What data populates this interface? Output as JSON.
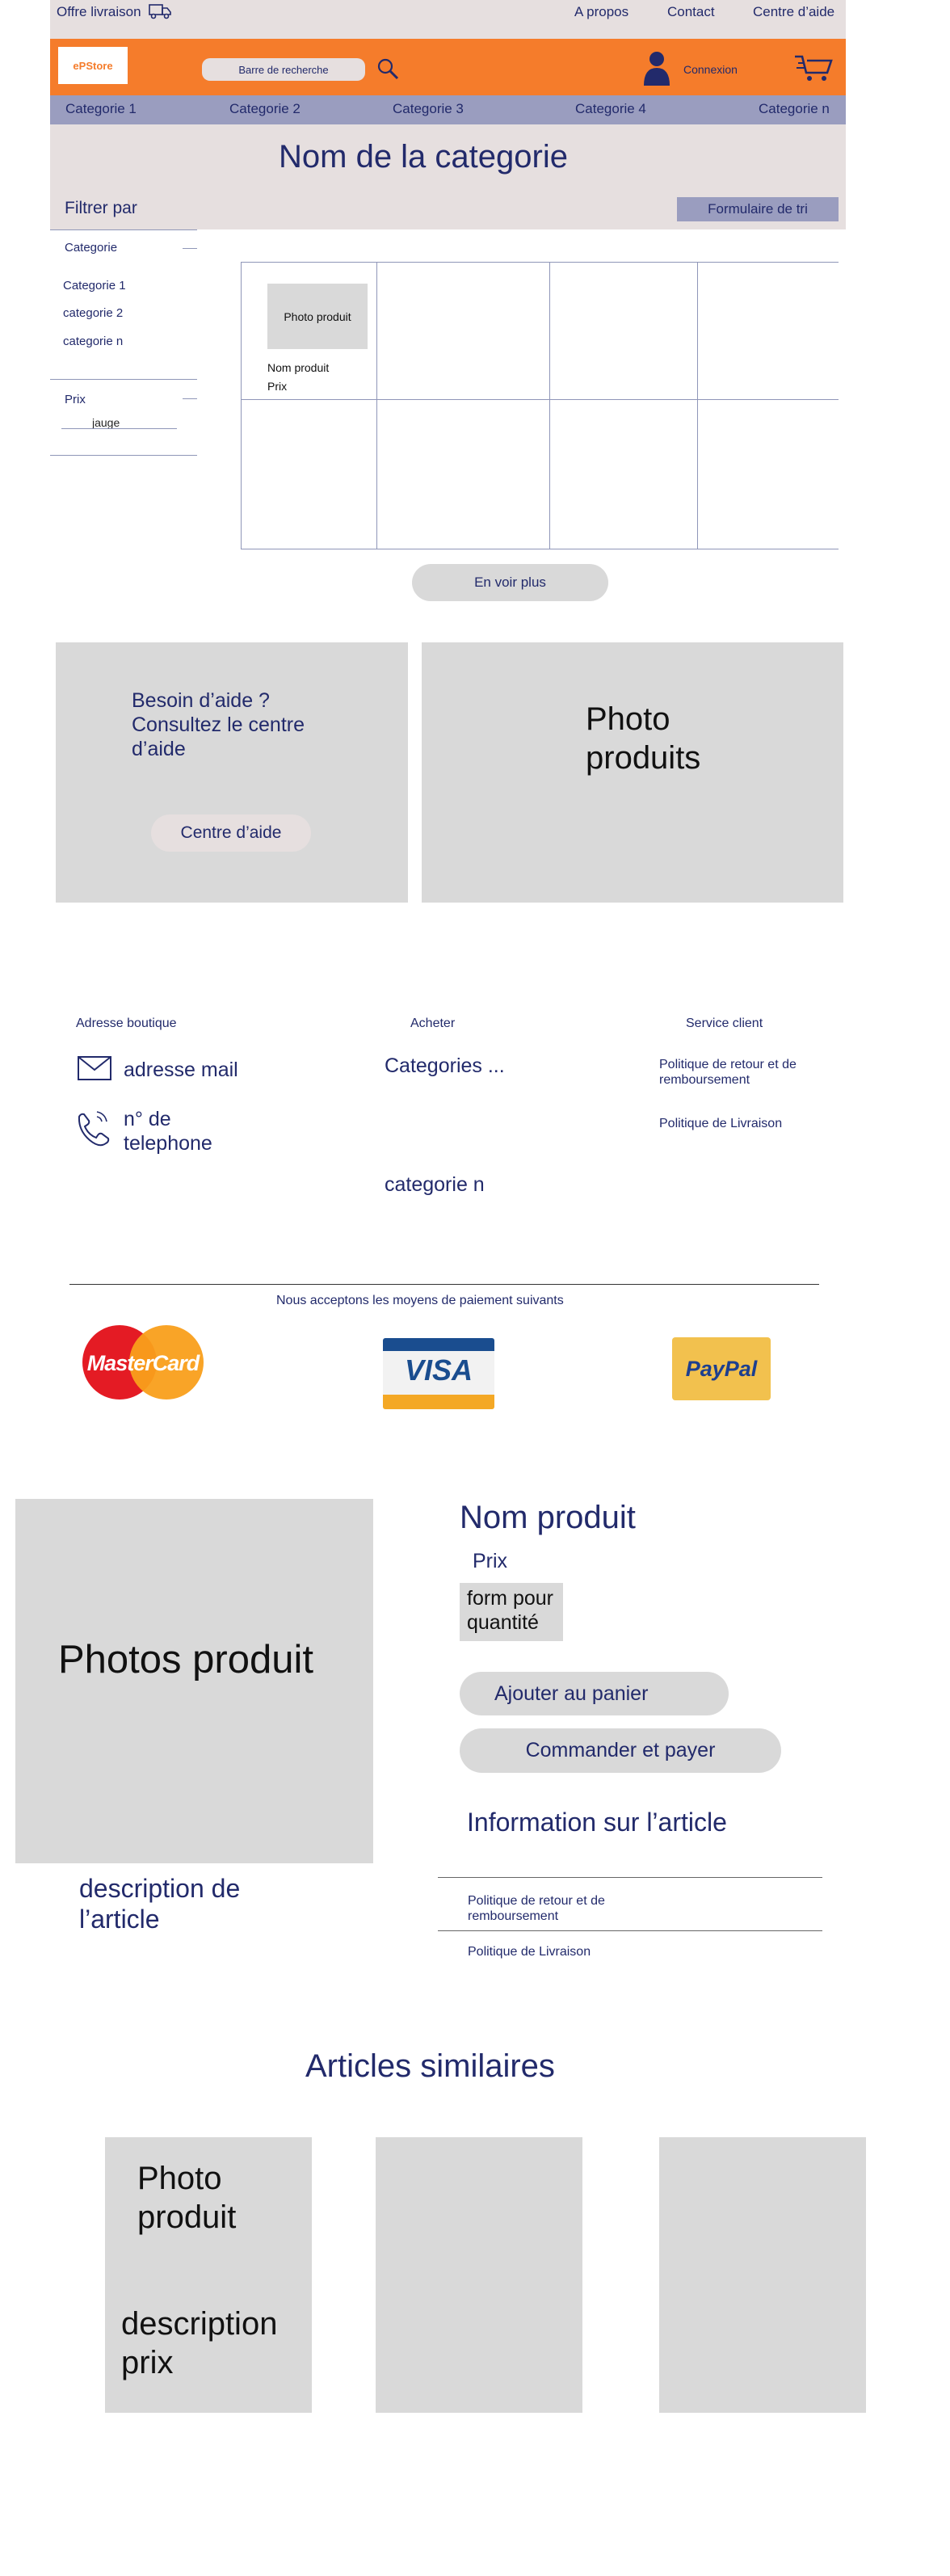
{
  "topbar": {
    "offer": "Offre livraison",
    "links": [
      "A propos",
      "Contact",
      "Centre d’aide"
    ]
  },
  "header": {
    "logo_text": "ePStore",
    "search_placeholder": "Barre de recherche",
    "login": "Connexion"
  },
  "categories_nav": [
    "Categorie 1",
    "Categorie 2",
    "Categorie 3",
    "Categorie 4",
    "Categorie n"
  ],
  "category_page": {
    "title": "Nom de la categorie",
    "filter_label": "Filtrer par",
    "sort_label": "Formulaire de tri",
    "filter_category_title": "Categorie",
    "filter_categories": [
      "Categorie 1",
      "categorie 2",
      "categorie n"
    ],
    "filter_price_title": "Prix",
    "price_gauge": "jauge",
    "product_photo": "Photo produit",
    "product_name": "Nom produit",
    "product_price": "Prix",
    "see_more": "En voir plus"
  },
  "help": {
    "text": "Besoin d’aide ? Consultez le centre d’aide",
    "button": "Centre d’aide",
    "photo": "Photo produits"
  },
  "footer": {
    "col1_title": "Adresse boutique",
    "email": "adresse mail",
    "phone": "n° de telephone",
    "col2_title": "Acheter",
    "categories": "Categories ...",
    "category_n": "categorie n",
    "col3_title": "Service client",
    "returns": "Politique de retour et de remboursement",
    "delivery": "Politique de Livraison",
    "payment_text": "Nous acceptons  les moyens de paiement suivants",
    "payments": [
      "MasterCard",
      "VISA",
      "PayPal"
    ]
  },
  "product_page": {
    "photos": "Photos produit",
    "name": "Nom produit",
    "price": "Prix",
    "quantity": "form pour quantité",
    "add_to_cart": "Ajouter au panier",
    "checkout": "Commander et payer",
    "info_title": "Information sur l’article",
    "returns": "Politique de retour et de remboursement",
    "delivery": "Politique de Livraison",
    "description": "description de l’article"
  },
  "similar": {
    "title": "Articles similaires",
    "photo": "Photo produit",
    "desc": "description prix"
  },
  "colors": {
    "orange": "#f57c2b",
    "navy": "#222a6b",
    "lavender": "#9a9dbf",
    "beige": "#e6dfdf",
    "gray": "#d9d9d9"
  }
}
